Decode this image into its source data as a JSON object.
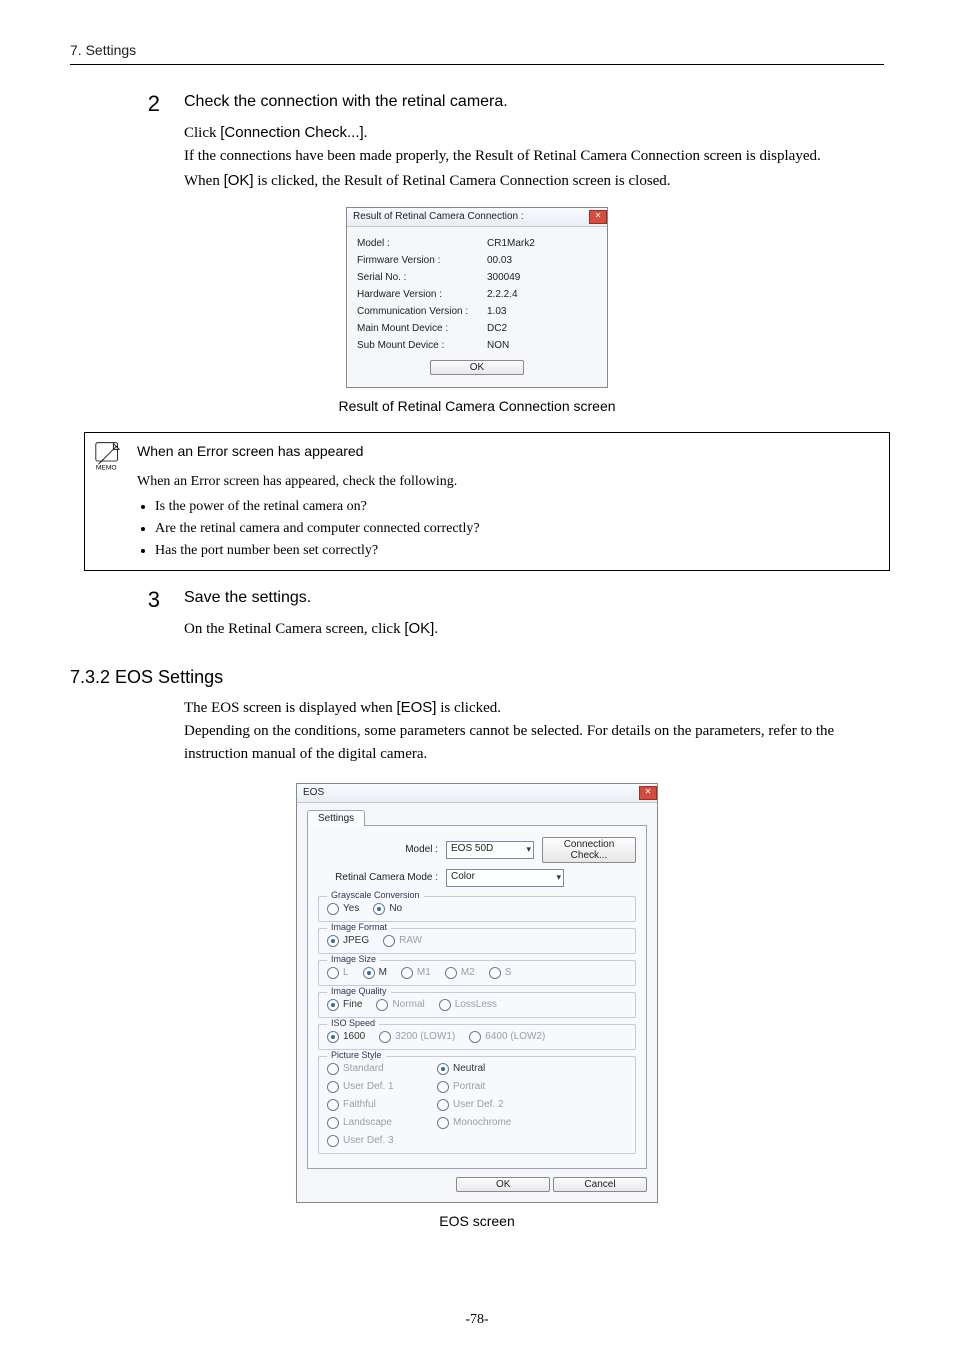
{
  "header": {
    "section": "7. Settings"
  },
  "step2": {
    "num": "2",
    "heading": "Check the connection with the retinal camera.",
    "p1_before": "Click ",
    "p1_ui": "[Connection Check...]",
    "p1_after": ".",
    "p2": "If the connections have been made properly, the Result of Retinal Camera Connection screen is displayed.",
    "p3_before": "When ",
    "p3_ui": "[OK]",
    "p3_after": " is clicked, the Result of Retinal Camera Connection screen is closed."
  },
  "dlg_result": {
    "title": "Result of Retinal Camera Connection :",
    "rows": {
      "model_l": "Model :",
      "model_v": "CR1Mark2",
      "fw_l": "Firmware Version :",
      "fw_v": "00.03",
      "serial_l": "Serial No. :",
      "serial_v": "300049",
      "hw_l": "Hardware Version :",
      "hw_v": "2.2.2.4",
      "comm_l": "Communication Version :",
      "comm_v": "1.03",
      "main_l": "Main Mount Device :",
      "main_v": "DC2",
      "sub_l": "Sub Mount Device :",
      "sub_v": "NON"
    },
    "ok": "OK",
    "caption": "Result of Retinal Camera Connection screen"
  },
  "memo": {
    "label": "MEMO",
    "heading": "When an Error screen has appeared",
    "p": "When an Error screen has appeared, check the following.",
    "b1": "Is the power of the retinal camera on?",
    "b2": "Are the retinal camera and computer connected correctly?",
    "b3": "Has the port number been set correctly?"
  },
  "step3": {
    "num": "3",
    "heading": "Save the settings.",
    "p_before": "On the Retinal Camera screen, click ",
    "p_ui": "[OK]",
    "p_after": "."
  },
  "h3": "7.3.2 EOS Settings",
  "eos_intro_before": "The EOS screen is displayed when ",
  "eos_intro_ui": "[EOS]",
  "eos_intro_after": " is clicked.",
  "eos_intro2": "Depending on the conditions, some parameters cannot be selected. For details on the parameters, refer to the instruction manual of the digital camera.",
  "eos": {
    "title": "EOS",
    "tab": "Settings",
    "model_l": "Model :",
    "model_v": "EOS 50D",
    "conn_btn_l1": "Connection",
    "conn_btn_l2": "Check...",
    "mode_l": "Retinal Camera Mode :",
    "mode_v": "Color",
    "grp_gray": "Grayscale Conversion",
    "gray_yes": "Yes",
    "gray_no": "No",
    "grp_fmt": "Image Format",
    "fmt_jpeg": "JPEG",
    "fmt_raw": "RAW",
    "grp_size": "Image Size",
    "sz_L": "L",
    "sz_M": "M",
    "sz_M1": "M1",
    "sz_M2": "M2",
    "sz_S": "S",
    "grp_q": "Image Quality",
    "q_fine": "Fine",
    "q_normal": "Normal",
    "q_ll": "LossLess",
    "grp_iso": "ISO Speed",
    "iso_1600": "1600",
    "iso_3200": "3200 (LOW1)",
    "iso_6400": "6400 (LOW2)",
    "grp_style": "Picture Style",
    "ps_std": "Standard",
    "ps_neu": "Neutral",
    "ps_ud1": "User Def. 1",
    "ps_por": "Portrait",
    "ps_fai": "Faithful",
    "ps_ud2": "User Def. 2",
    "ps_lan": "Landscape",
    "ps_mon": "Monochrome",
    "ps_ud3": "User Def. 3",
    "ok": "OK",
    "cancel": "Cancel",
    "caption": "EOS screen"
  },
  "page_num": "-78-"
}
